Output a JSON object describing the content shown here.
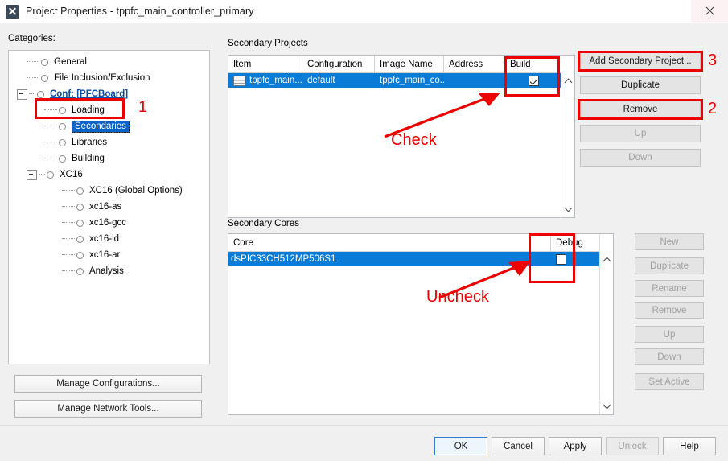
{
  "window": {
    "title": "Project Properties - tppfc_main_controller_primary",
    "icon": "app-x-icon",
    "close_label": "✕"
  },
  "left": {
    "categories_label": "Categories:",
    "tree": [
      {
        "label": "General",
        "indent": 1,
        "expander": false,
        "style": "normal"
      },
      {
        "label": "File Inclusion/Exclusion",
        "indent": 1,
        "expander": false,
        "style": "normal"
      },
      {
        "label": "Conf: [PFCBoard]",
        "indent": 0,
        "expander": true,
        "style": "link"
      },
      {
        "label": "Loading",
        "indent": 2,
        "expander": false,
        "style": "normal"
      },
      {
        "label": "Secondaries",
        "indent": 2,
        "expander": false,
        "style": "selected"
      },
      {
        "label": "Libraries",
        "indent": 2,
        "expander": false,
        "style": "normal"
      },
      {
        "label": "Building",
        "indent": 2,
        "expander": false,
        "style": "normal"
      },
      {
        "label": "XC16",
        "indent": 1,
        "expander": true,
        "style": "normal"
      },
      {
        "label": "XC16 (Global Options)",
        "indent": 3,
        "expander": false,
        "style": "normal"
      },
      {
        "label": "xc16-as",
        "indent": 3,
        "expander": false,
        "style": "normal"
      },
      {
        "label": "xc16-gcc",
        "indent": 3,
        "expander": false,
        "style": "normal"
      },
      {
        "label": "xc16-ld",
        "indent": 3,
        "expander": false,
        "style": "normal"
      },
      {
        "label": "xc16-ar",
        "indent": 3,
        "expander": false,
        "style": "normal"
      },
      {
        "label": "Analysis",
        "indent": 3,
        "expander": false,
        "style": "normal"
      }
    ],
    "manage_configurations_label": "Manage Configurations...",
    "manage_network_tools_label": "Manage Network Tools..."
  },
  "secondary_projects": {
    "label": "Secondary Projects",
    "columns": [
      "Item",
      "Configuration",
      "Image Name",
      "Address",
      "Build"
    ],
    "rows": [
      {
        "item": "tppfc_main...",
        "configuration": "default",
        "image_name": "tppfc_main_co...",
        "address": "",
        "build": true,
        "selected": true
      }
    ],
    "buttons": [
      {
        "label": "Add Secondary Project...",
        "enabled": true
      },
      {
        "label": "Duplicate",
        "enabled": true
      },
      {
        "label": "Remove",
        "enabled": true
      },
      {
        "label": "Up",
        "enabled": false
      },
      {
        "label": "Down",
        "enabled": false
      }
    ]
  },
  "secondary_cores": {
    "label": "Secondary Cores",
    "columns": [
      "Core",
      "",
      "Debug"
    ],
    "rows": [
      {
        "core": "dsPIC33CH512MP506S1",
        "debug": false,
        "selected": true
      }
    ],
    "buttons": [
      {
        "label": "New",
        "enabled": false
      },
      {
        "label": "Duplicate",
        "enabled": false
      },
      {
        "label": "Rename",
        "enabled": false
      },
      {
        "label": "Remove",
        "enabled": false
      },
      {
        "label": "Up",
        "enabled": false
      },
      {
        "label": "Down",
        "enabled": false
      },
      {
        "label": "Set Active",
        "enabled": false
      }
    ]
  },
  "footer": {
    "buttons": [
      {
        "label": "OK",
        "enabled": true,
        "default": true
      },
      {
        "label": "Cancel",
        "enabled": true,
        "default": false
      },
      {
        "label": "Apply",
        "enabled": true,
        "default": false
      },
      {
        "label": "Unlock",
        "enabled": false,
        "default": false
      },
      {
        "label": "Help",
        "enabled": true,
        "default": false
      }
    ]
  },
  "annotations": {
    "color": "#ee0000",
    "step1": "1",
    "step2": "2",
    "step3": "3",
    "check_text": "Check",
    "uncheck_text": "Uncheck"
  }
}
